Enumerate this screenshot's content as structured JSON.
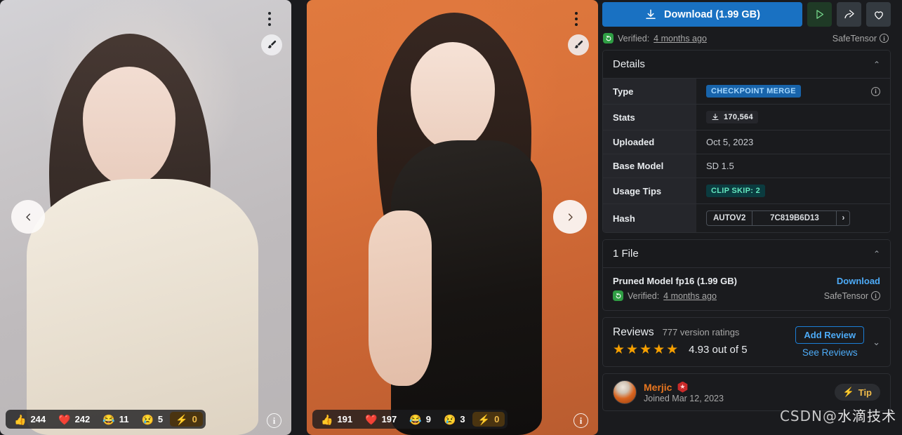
{
  "gallery": {
    "prev_label": "‹",
    "next_label": "›",
    "menu_name": "more-options",
    "brush_name": "paintbrush",
    "info_label": "i",
    "images": [
      {
        "alt": "Portrait of woman in cream knit sweater on grey background",
        "reactions": [
          {
            "icon": "👍",
            "count": "244",
            "kind": "like"
          },
          {
            "icon": "❤️",
            "count": "242",
            "kind": "heart"
          },
          {
            "icon": "😂",
            "count": "11",
            "kind": "laugh"
          },
          {
            "icon": "😢",
            "count": "5",
            "kind": "cry"
          },
          {
            "icon": "⚡",
            "count": "0",
            "kind": "bolt"
          }
        ]
      },
      {
        "alt": "Portrait of woman in black slip dress on orange background",
        "reactions": [
          {
            "icon": "👍",
            "count": "191",
            "kind": "like"
          },
          {
            "icon": "❤️",
            "count": "197",
            "kind": "heart"
          },
          {
            "icon": "😂",
            "count": "9",
            "kind": "laugh"
          },
          {
            "icon": "😢",
            "count": "3",
            "kind": "cry"
          },
          {
            "icon": "⚡",
            "count": "0",
            "kind": "bolt"
          }
        ]
      }
    ]
  },
  "actions": {
    "download_label": "Download (1.99 GB)",
    "run_title": "Run model",
    "share_title": "Share",
    "favorite_title": "Favorite",
    "accent_blue": "#1971c2",
    "run_green": "#74d48a"
  },
  "verified": {
    "prefix": "Verified:",
    "time": "4 months ago",
    "format": "SafeTensor",
    "info_label": "i"
  },
  "details": {
    "title": "Details",
    "collapse_icon": "⌃",
    "rows": [
      {
        "key": "Type",
        "value": "CHECKPOINT MERGE",
        "style": "badge-type",
        "has_info": true
      },
      {
        "key": "Stats",
        "value": "170,564",
        "style": "badge-stat",
        "has_info": false
      },
      {
        "key": "Uploaded",
        "value": "Oct 5, 2023",
        "style": "plain",
        "has_info": false
      },
      {
        "key": "Base Model",
        "value": "SD 1.5",
        "style": "plain",
        "has_info": false
      },
      {
        "key": "Usage Tips",
        "value": "CLIP SKIP: 2",
        "style": "badge-tips",
        "has_info": false
      },
      {
        "key": "Hash",
        "value": "7C819B6D13",
        "style": "hash",
        "has_info": false
      }
    ],
    "hash_algo": "AUTOV2",
    "hash_expand": "›",
    "info_label": "i"
  },
  "files": {
    "title": "1 File",
    "collapse_icon": "⌃",
    "items": [
      {
        "name": "Pruned Model fp16 (1.99 GB)",
        "download_label": "Download",
        "verified_prefix": "Verified:",
        "verified_time": "4 months ago",
        "format": "SafeTensor",
        "info_label": "i"
      }
    ]
  },
  "reviews": {
    "title": "Reviews",
    "ratings_count": "777 version ratings",
    "stars": "★★★★★",
    "score": "4.93 out of 5",
    "add_label": "Add Review",
    "see_label": "See Reviews",
    "expand_icon": "⌄",
    "star_color": "#f59f00"
  },
  "creator": {
    "name": "Merjic",
    "badge_icon": "★",
    "joined": "Joined Mar 12, 2023",
    "tip_icon": "⚡",
    "tip_label": "Tip"
  },
  "watermark": {
    "prefix": "CSDN@",
    "text": "水滴技术"
  }
}
